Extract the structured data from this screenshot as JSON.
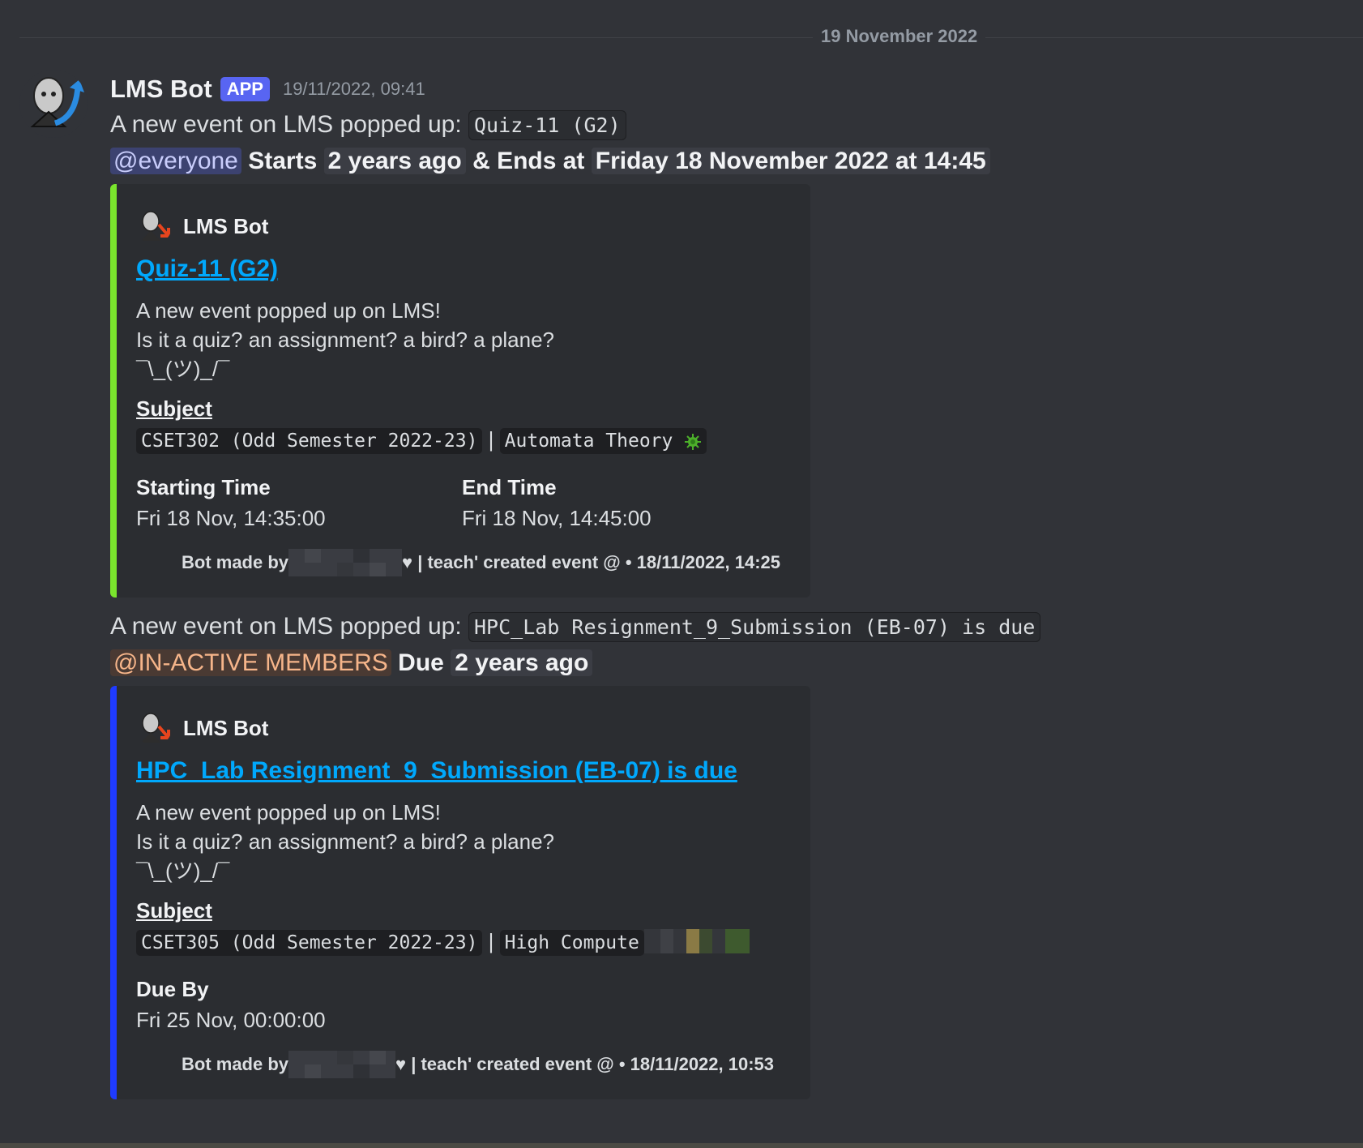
{
  "date_divider": "19 November 2022",
  "message": {
    "username": "LMS Bot",
    "badge": "APP",
    "timestamp": "19/11/2022, 09:41"
  },
  "post1": {
    "prefix": "A new event on LMS popped up:",
    "code": "Quiz-11 (G2)",
    "mention": "@everyone",
    "starts_label": "Starts",
    "starts_value": "2 years ago",
    "ends_label": "& Ends at",
    "ends_value": "Friday 18 November 2022 at 14:45",
    "accent": "#7ae52d",
    "embed": {
      "author": "LMS Bot",
      "title": "Quiz-11 (G2)",
      "desc": "A new event popped up on LMS!\nIs it a quiz? an assignment? a bird? a plane?\n¯\\_(ツ)_/¯",
      "subject_label": "Subject",
      "subject_code": "CSET302 (Odd Semester 2022-23)",
      "subject_sep": "|",
      "subject_name": "Automata Theory",
      "start_label": "Starting Time",
      "start_value": "Fri 18 Nov, 14:35:00",
      "end_label": "End Time",
      "end_value": "Fri 18 Nov, 14:45:00",
      "footer_prefix": "Bot made by",
      "footer_suffix": "♥ | teach' created event @ • 18/11/2022, 14:25"
    }
  },
  "post2": {
    "prefix": "A new event on LMS popped up:",
    "code": "HPC_Lab Resignment_9_Submission (EB-07) is due",
    "mention": "@IN-ACTIVE MEMBERS",
    "due_label": "Due",
    "due_value": "2 years ago",
    "accent": "#1f3bff",
    "embed": {
      "author": "LMS Bot",
      "title": "HPC_Lab Resignment_9_Submission (EB-07) is due",
      "desc": "A new event popped up on LMS!\nIs it a quiz? an assignment? a bird? a plane?\n¯\\_(ツ)_/¯",
      "subject_label": "Subject",
      "subject_code": "CSET305 (Odd Semester 2022-23)",
      "subject_sep": "|",
      "subject_name": "High Compute",
      "due_label": "Due By",
      "due_value": "Fri 25 Nov, 00:00:00",
      "footer_prefix": "Bot made by",
      "footer_suffix": "♥ | teach' created event @ • 18/11/2022, 10:53"
    }
  }
}
